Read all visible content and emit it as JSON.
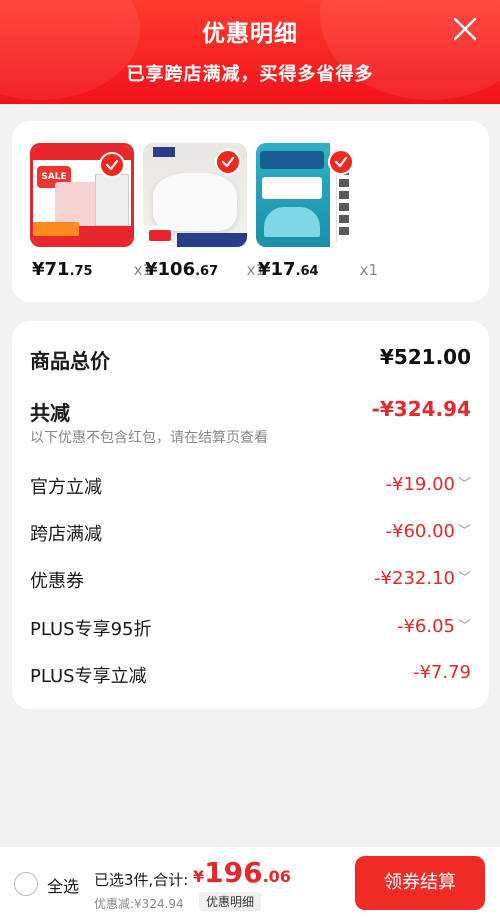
{
  "header": {
    "title": "优惠明细",
    "subtitle": "已享跨店满减，买得多省得多"
  },
  "products": [
    {
      "price_int": "¥71",
      "price_dec": ".75",
      "qty": "x1",
      "selected": true
    },
    {
      "price_int": "¥106",
      "price_dec": ".67",
      "qty": "x1",
      "selected": true
    },
    {
      "price_int": "¥17",
      "price_dec": ".64",
      "qty": "x1",
      "selected": true
    }
  ],
  "summary": {
    "total_label": "商品总价",
    "total_value": "¥521.00",
    "reduce_label": "共减",
    "reduce_value": "-¥324.94",
    "note": "以下优惠不包含红包，请在结算页查看",
    "items": [
      {
        "label": "官方立减",
        "value": "-¥19.00"
      },
      {
        "label": "跨店满减",
        "value": "-¥60.00"
      },
      {
        "label": "优惠券",
        "value": "-¥232.10"
      },
      {
        "label": "PLUS专享95折",
        "value": "-¥6.05"
      },
      {
        "label": "PLUS专享立减",
        "value": "-¥7.79"
      }
    ]
  },
  "bottom": {
    "select_all": "全选",
    "selected_info": "已选3件,合计:",
    "price_currency": "¥",
    "price_int": "196",
    "price_dec": ".06",
    "discount": "优惠减:¥324.94",
    "detail_button": "优惠明细",
    "checkout_button": "领券结算"
  },
  "colors": {
    "accent": "#f02b25",
    "price_red": "#e8262d"
  }
}
